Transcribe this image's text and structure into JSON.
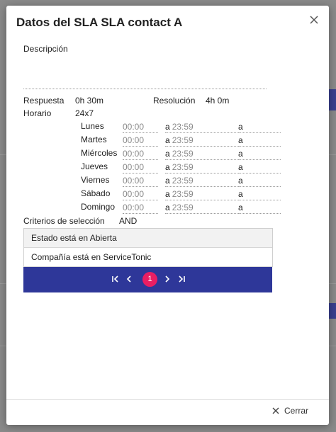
{
  "dialog": {
    "title": "Datos del SLA SLA contact A",
    "close_icon": "close-icon"
  },
  "description": {
    "label": "Descripción",
    "value": ""
  },
  "response": {
    "label": "Respuesta",
    "value": "0h 30m"
  },
  "resolution": {
    "label": "Resolución",
    "value": "4h 0m"
  },
  "schedule": {
    "label": "Horario",
    "value": "24x7",
    "separator": "a",
    "days": [
      {
        "name": "Lunes",
        "from": "00:00",
        "to": "23:59"
      },
      {
        "name": "Martes",
        "from": "00:00",
        "to": "23:59"
      },
      {
        "name": "Miércoles",
        "from": "00:00",
        "to": "23:59"
      },
      {
        "name": "Jueves",
        "from": "00:00",
        "to": "23:59"
      },
      {
        "name": "Viernes",
        "from": "00:00",
        "to": "23:59"
      },
      {
        "name": "Sábado",
        "from": "00:00",
        "to": "23:59"
      },
      {
        "name": "Domingo",
        "from": "00:00",
        "to": "23:59"
      }
    ]
  },
  "criteria": {
    "label": "Criterios de selección",
    "operator": "AND",
    "rows": [
      "Estado está en Abierta",
      "Compañía está en ServiceTonic"
    ]
  },
  "pagination": {
    "current_page": "1",
    "icons": [
      "first-page-icon",
      "prev-page-icon",
      "next-page-icon",
      "last-page-icon"
    ]
  },
  "footer": {
    "close_label": "Cerrar"
  },
  "colors": {
    "pager_bg": "#2e3799",
    "page_bubble": "#e91e63",
    "overlay": "#8a8a8a"
  }
}
